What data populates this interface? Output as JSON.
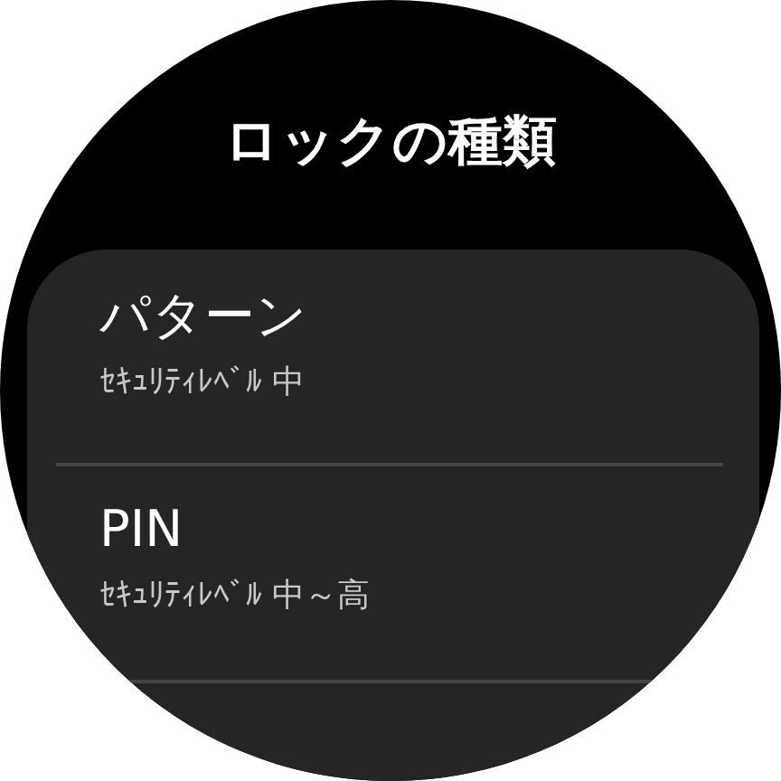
{
  "title": "ロックの種類",
  "items": [
    {
      "label": "パターン",
      "detail": "ｾｷｭﾘﾃｨﾚﾍﾞﾙ 中"
    },
    {
      "label": "PIN",
      "detail": "ｾｷｭﾘﾃｨﾚﾍﾞﾙ 中～高"
    }
  ]
}
